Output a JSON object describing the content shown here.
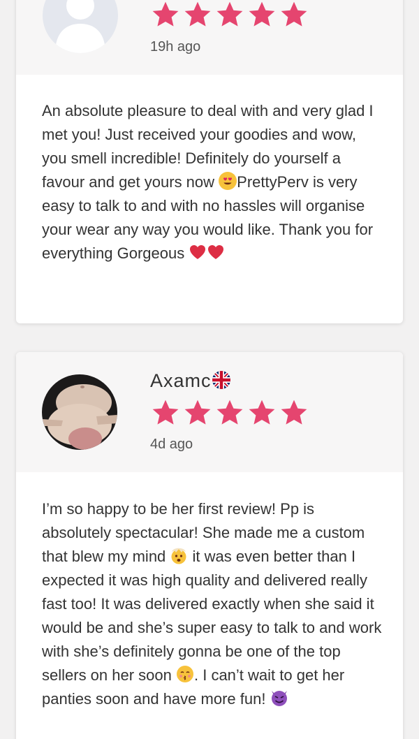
{
  "colors": {
    "star": "#e5456f",
    "page_bg": "#f2f1f1",
    "card_bg": "#ffffff",
    "header_bg": "#f7f6f6",
    "text": "#333333"
  },
  "review1": {
    "time": "19h ago",
    "rating": 5,
    "text_part1": "An absolute pleasure to deal with and very glad I met you! Just received your goodies and wow, you smell incredible! Definitely do yourself a favour and get yours now ",
    "emoji1": "heart-eyes-emoji",
    "text_part2": "PrettyPerv is very easy to talk to and with no hassles will organise your wear any way you would like. Thank you for everything Gorgeous ",
    "emoji2": "red-heart-emoji"
  },
  "review2": {
    "name": "Axamc",
    "flag": "uk-flag-icon",
    "time": "4d ago",
    "rating": 5,
    "text_part1": "I’m so happy to be her first review! Pp is absolutely spectacular! She made me a custom that blew my mind ",
    "emoji1": "exploding-head-emoji",
    "text_part2": " it was even better than I expected it was high quality and delivered really fast too! It was delivered exactly when she said it would be and she’s super easy to talk to and work with she’s definitely gonna be one of the top sellers on her soon ",
    "emoji2": "kissing-emoji",
    "text_part3": ". I can’t wait to get her panties soon and have more fun! ",
    "emoji3": "devil-emoji"
  }
}
